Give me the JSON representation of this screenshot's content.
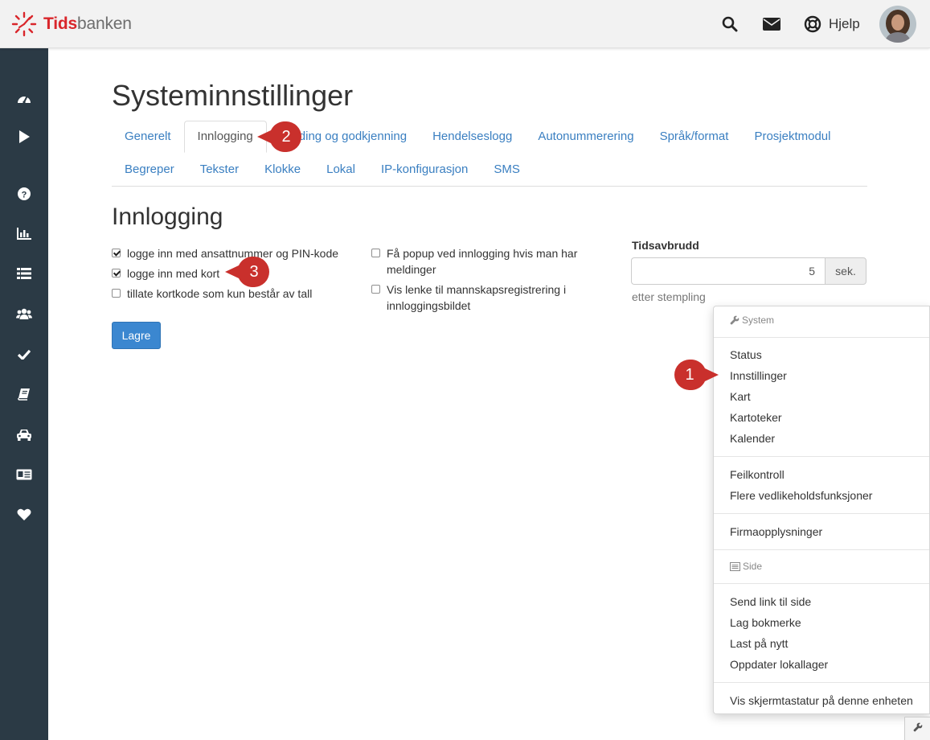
{
  "header": {
    "logo_part1": "Tids",
    "logo_part2": "banken",
    "help_label": "Hjelp"
  },
  "colors": {
    "brand_red": "#d9262b",
    "sidebar_bg": "#2b3a45",
    "link_blue": "#3a7fc1",
    "primary_button": "#3b87d0",
    "callout_red": "#c9302c"
  },
  "page": {
    "title": "Systeminnstillinger",
    "tabs_row1": [
      {
        "label": "Generelt"
      },
      {
        "label": "Innlogging"
      },
      {
        "label": "ding og godkjenning"
      },
      {
        "label": "Hendelseslogg"
      },
      {
        "label": "Autonummerering"
      },
      {
        "label": "Språk/format"
      },
      {
        "label": "Prosjektmodul"
      }
    ],
    "tabs_row2": [
      {
        "label": "Begreper"
      },
      {
        "label": "Tekster"
      },
      {
        "label": "Klokke"
      },
      {
        "label": "Lokal"
      },
      {
        "label": "IP-konfigurasjon"
      },
      {
        "label": "SMS"
      }
    ],
    "active_tab": "Innlogging",
    "section_title": "Innlogging"
  },
  "login_settings": {
    "left": [
      {
        "label": "logge inn med ansattnummer og PIN-kode",
        "checked": true
      },
      {
        "label": "logge inn med kort",
        "checked": true
      },
      {
        "label": "tillate kortkode som kun består av tall",
        "checked": false
      }
    ],
    "right": [
      {
        "label": "Få popup ved innlogging hvis man har meldinger",
        "checked": false
      },
      {
        "label": "Vis lenke til mannskapsregistrering i innloggingsbildet",
        "checked": false
      }
    ],
    "save_label": "Lagre"
  },
  "timeout": {
    "label": "Tidsavbrudd",
    "value": "5",
    "unit": "sek.",
    "help": "etter stempling"
  },
  "callouts": {
    "one": "1",
    "two": "2",
    "three": "3"
  },
  "dropdown": {
    "system_header": "System",
    "group1": [
      "Status",
      "Innstillinger",
      "Kart",
      "Kartoteker",
      "Kalender"
    ],
    "group2": [
      "Feilkontroll",
      "Flere vedlikeholdsfunksjoner"
    ],
    "group3": [
      "Firmaopplysninger"
    ],
    "side_header": "Side",
    "group4": [
      "Send link til side",
      "Lag bokmerke",
      "Last på nytt",
      "Oppdater lokallager"
    ],
    "group5": [
      "Vis skjermtastatur på denne enheten"
    ]
  }
}
